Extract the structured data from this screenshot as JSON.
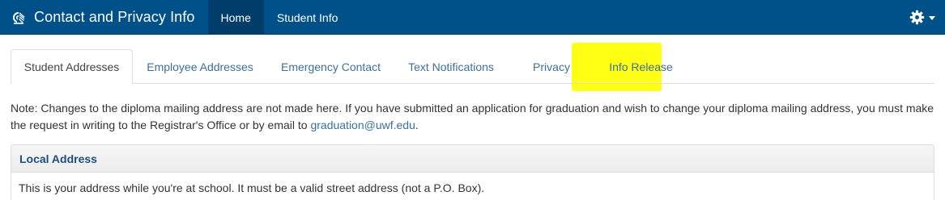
{
  "navbar": {
    "app_title": "Contact and Privacy Info",
    "logo_icon": "uwf-nautilus-logo-icon",
    "items": [
      {
        "label": "Home",
        "active": true
      },
      {
        "label": "Student Info",
        "active": false
      }
    ],
    "settings_icon": "gear-icon"
  },
  "tabs": [
    {
      "label": "Student Addresses",
      "active": true
    },
    {
      "label": "Employee Addresses",
      "active": false
    },
    {
      "label": "Emergency Contact",
      "active": false
    },
    {
      "label": "Text Notifications",
      "active": false
    },
    {
      "label": "Privacy",
      "active": false
    },
    {
      "label": "Info Release",
      "active": false,
      "highlighted": true
    }
  ],
  "note": {
    "text": "Note: Changes to the diploma mailing address are not made here. If you have submitted an application for graduation and wish to change your diploma mailing address, you must make the request in writing to the Registrar's Office or by email to ",
    "email": "graduation@uwf.edu",
    "text_end": "."
  },
  "panel": {
    "title": "Local Address",
    "body": "This is your address while you're at school. It must be a valid street address (not a P.O. Box)."
  },
  "colors": {
    "navbar_bg": "#00508a",
    "navbar_active": "#003d6b",
    "link": "#3a70a0",
    "highlight": "#ffff00"
  }
}
